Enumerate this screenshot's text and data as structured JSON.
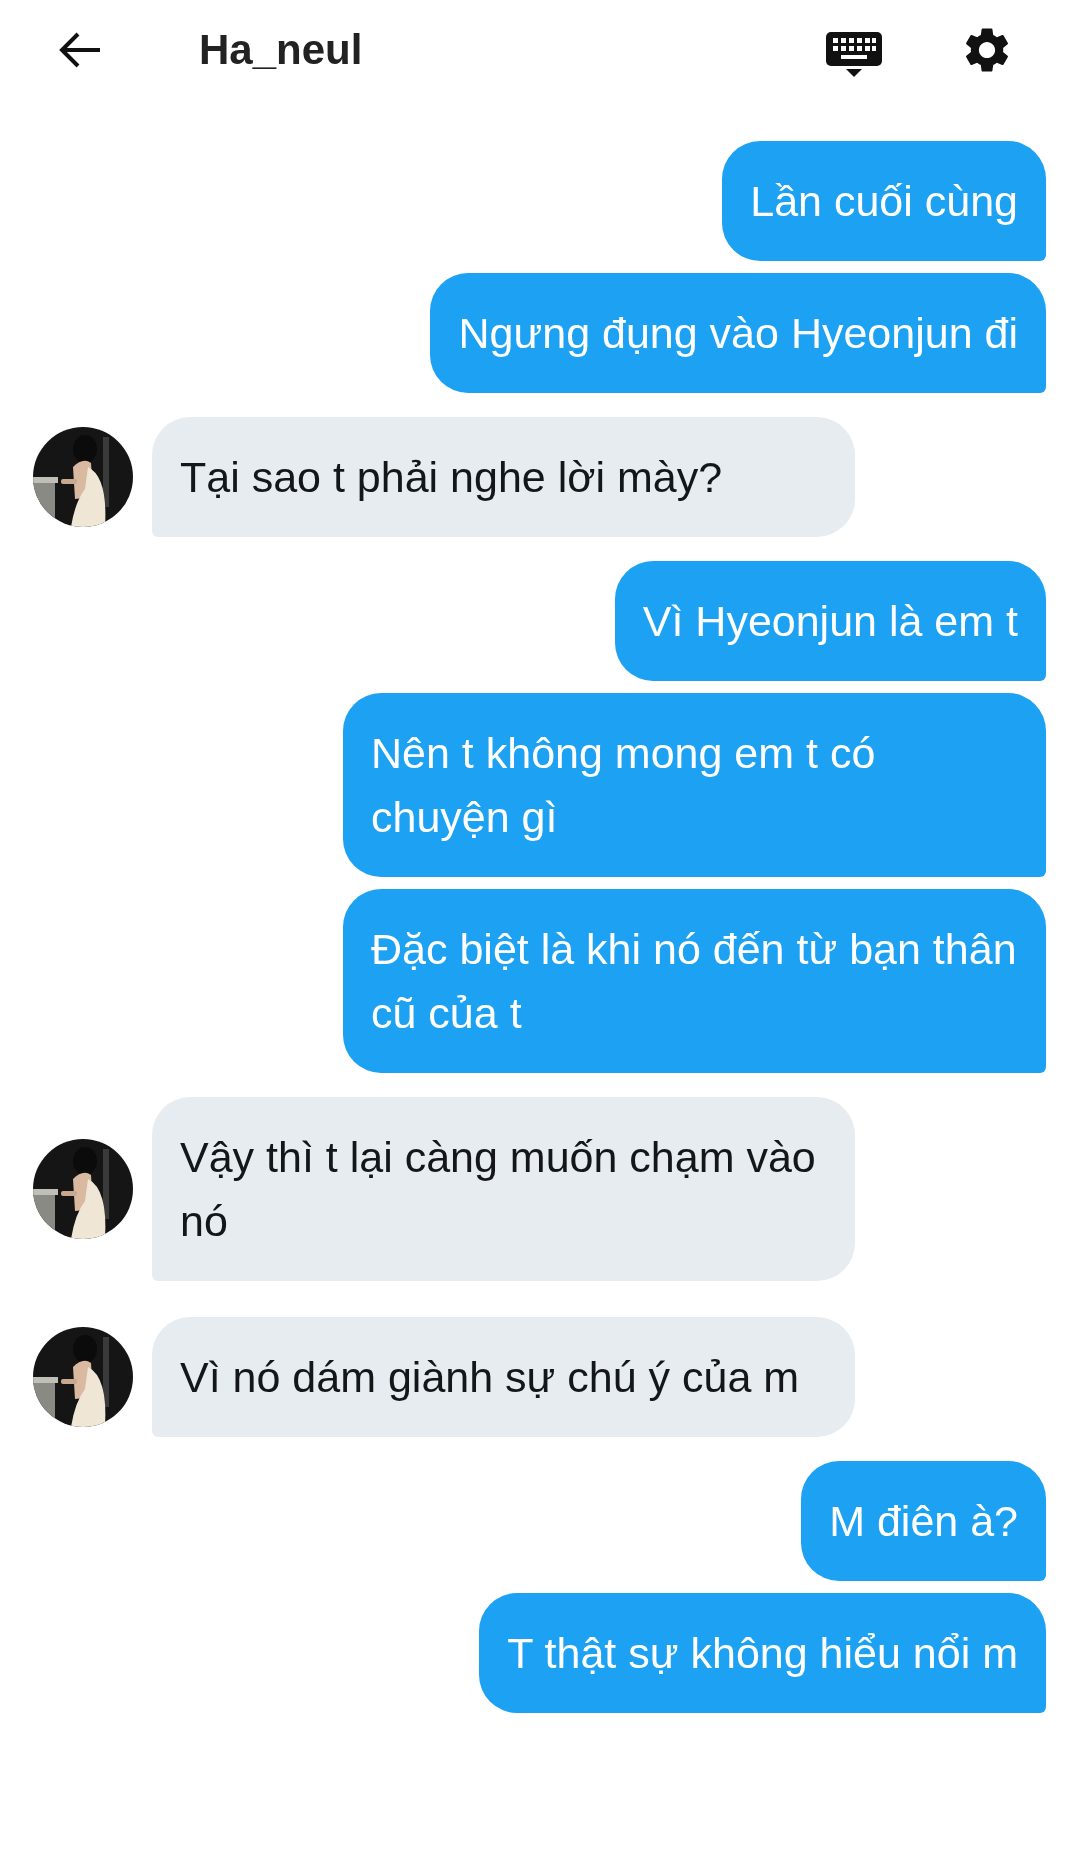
{
  "header": {
    "title": "Ha_neul"
  },
  "messages": [
    {
      "kind": "outgoing",
      "text": "Lần cuối cùng"
    },
    {
      "kind": "outgoing",
      "text": "Ngưng đụng vào Hyeonjun đi"
    },
    {
      "kind": "incoming",
      "text": "Tại sao t phải nghe lời mày?"
    },
    {
      "kind": "outgoing",
      "text": "Vì Hyeonjun là em t"
    },
    {
      "kind": "outgoing",
      "text": "Nên t không mong em t có chuyện gì"
    },
    {
      "kind": "outgoing",
      "text": "Đặc biệt là khi nó đến từ bạn thân cũ của t"
    },
    {
      "kind": "incoming",
      "text": "Vậy thì t lại càng muốn chạm vào nó"
    },
    {
      "kind": "incoming",
      "text": "Vì nó dám giành sự chú ý của m"
    },
    {
      "kind": "outgoing",
      "text": "M điên à?"
    },
    {
      "kind": "outgoing",
      "text": "T thật sự không hiểu nổi m"
    }
  ]
}
